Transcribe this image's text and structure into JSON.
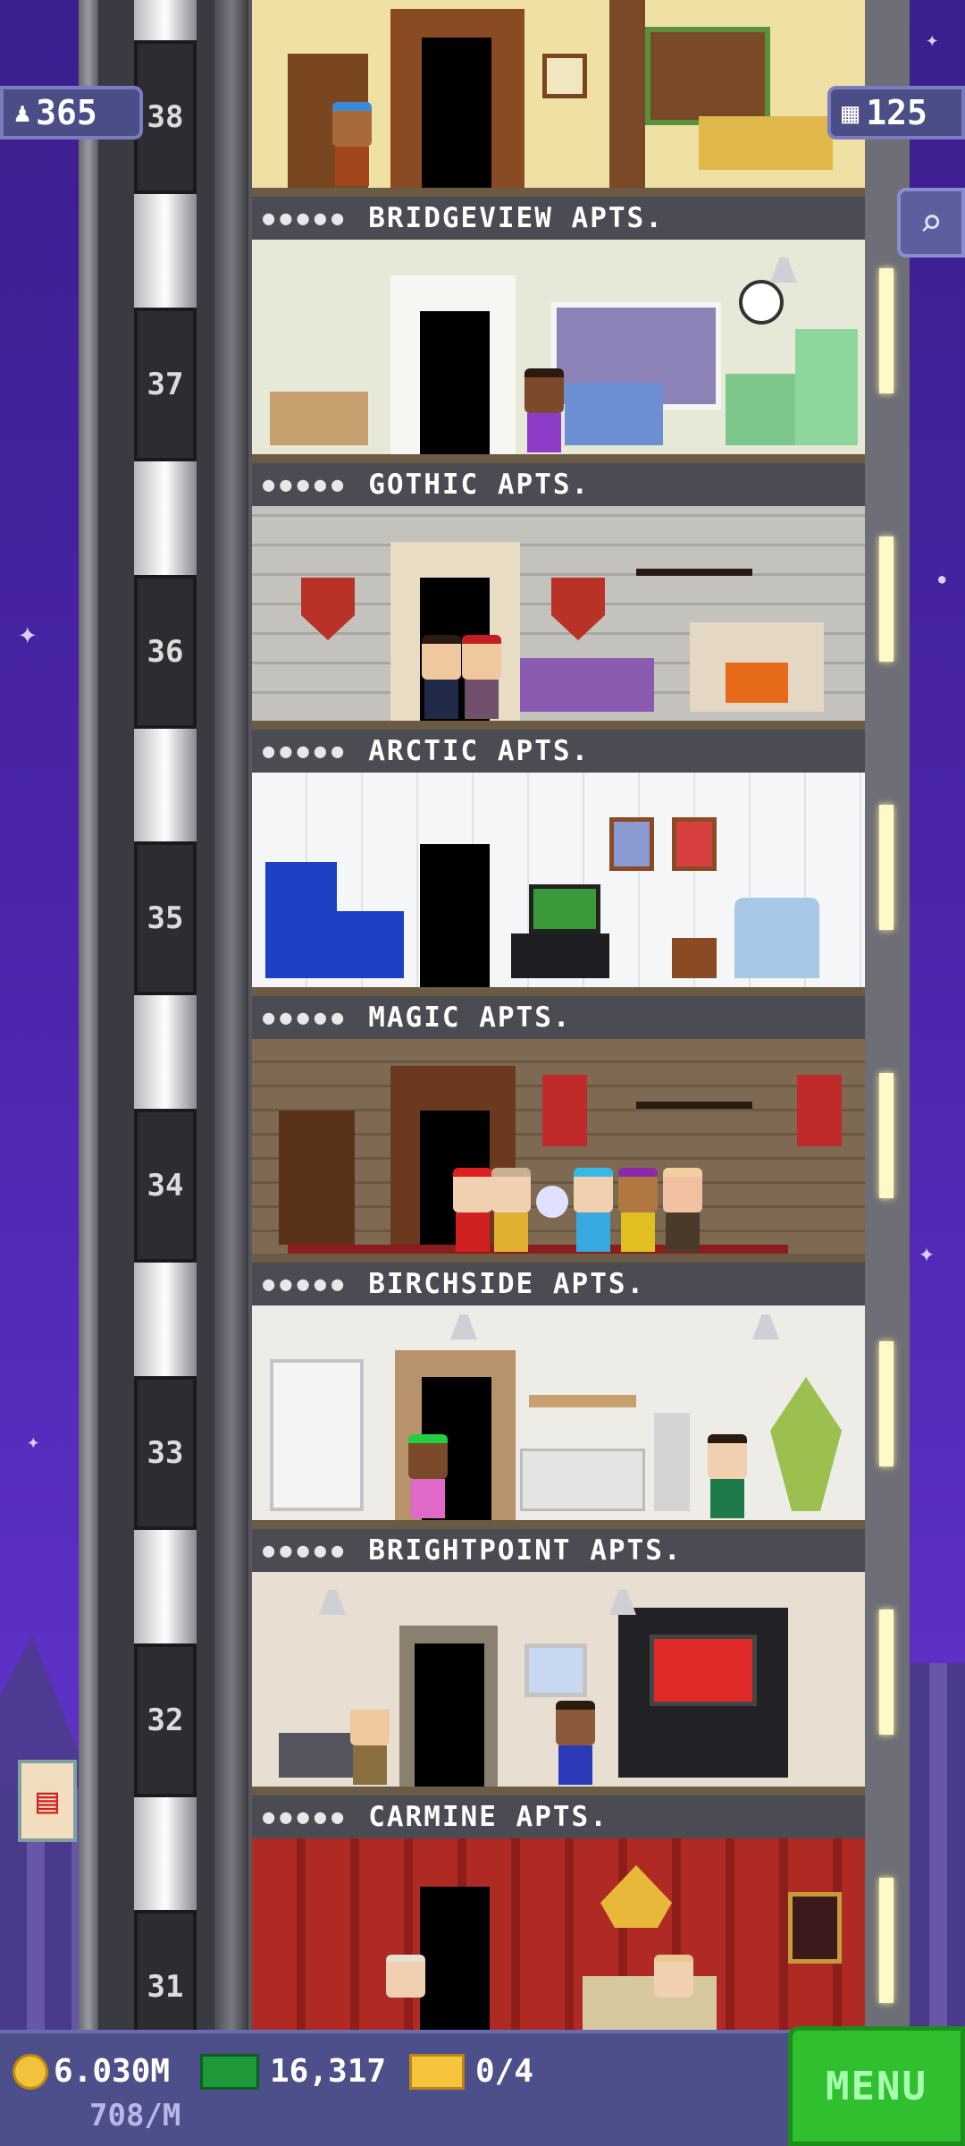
{
  "hud": {
    "population": "365",
    "floors_count": "125"
  },
  "floors": [
    {
      "number": "38",
      "name": "",
      "bg": "#efe1a4"
    },
    {
      "number": "37",
      "name": "BRIDGEVIEW APTS.",
      "bg": "#e7e9d8"
    },
    {
      "number": "36",
      "name": "GOTHIC APTS.",
      "bg": "#b9b7b3"
    },
    {
      "number": "35",
      "name": "ARCTIC APTS.",
      "bg": "#f1f4f6"
    },
    {
      "number": "34",
      "name": "MAGIC APTS.",
      "bg": "#7b6650"
    },
    {
      "number": "33",
      "name": "BIRCHSIDE APTS.",
      "bg": "#eeece6"
    },
    {
      "number": "32",
      "name": "BRIGHTPOINT APTS.",
      "bg": "#e8ded2"
    },
    {
      "number": "31",
      "name": "CARMINE APTS.",
      "bg": "#b02a24"
    }
  ],
  "bottom_bar": {
    "coins": "6.030M",
    "coins_rate": "708/M",
    "bux": "16,317",
    "tickets": "0/4",
    "menu_label": "MENU"
  },
  "icons": [
    "population-icon",
    "floors-icon",
    "search-icon",
    "coin-icon",
    "bux-icon",
    "ticket-icon",
    "ad-fries-icon"
  ]
}
